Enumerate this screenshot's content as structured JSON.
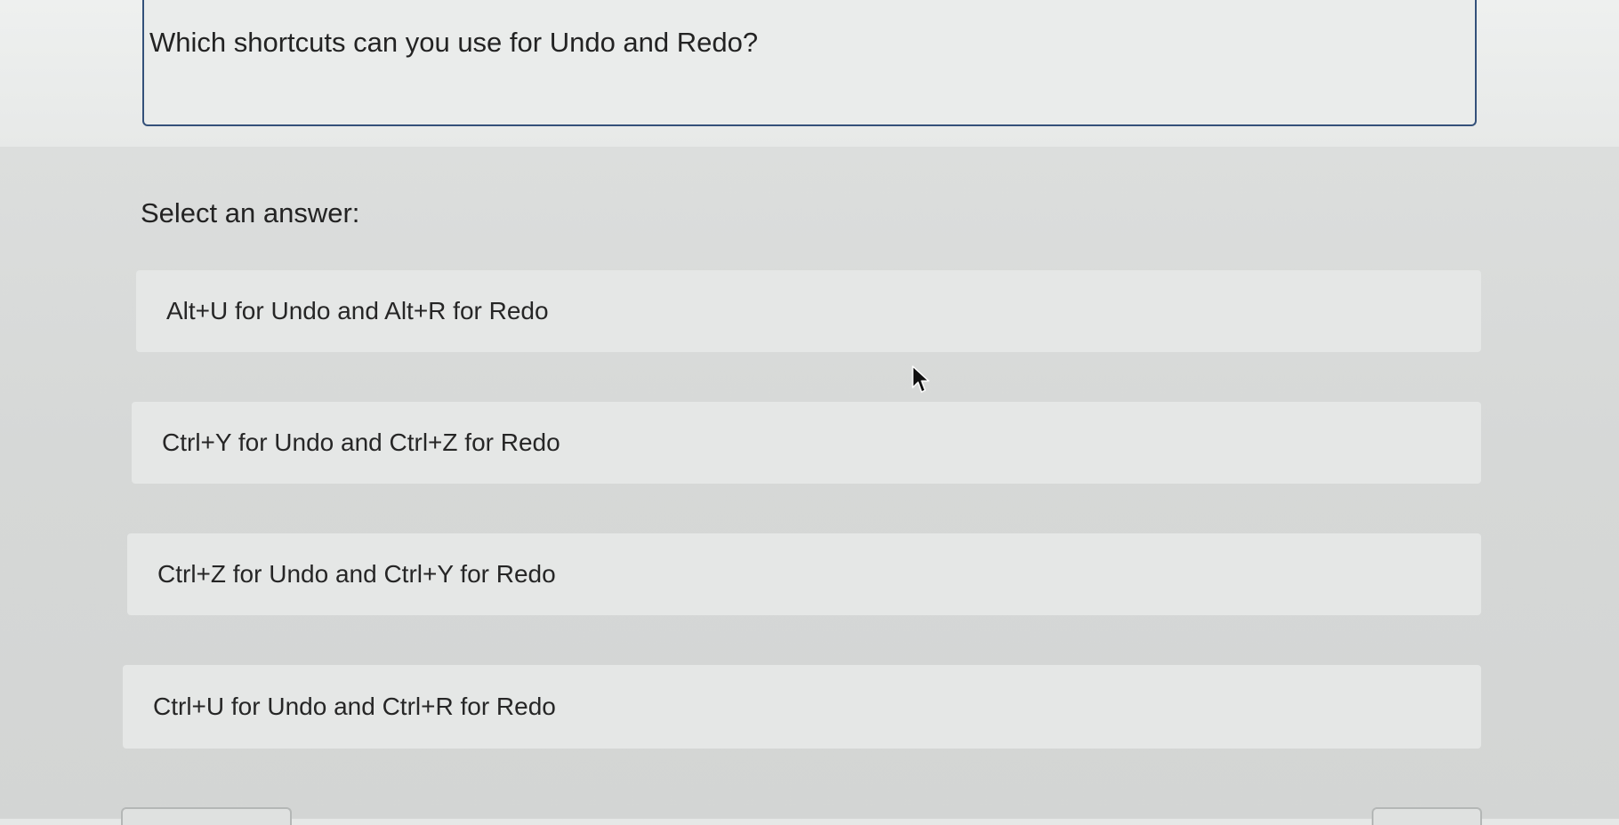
{
  "question": {
    "text": "Which shortcuts can you use for Undo and Redo?"
  },
  "prompt": {
    "text": "Select an answer:"
  },
  "options": [
    {
      "label": "Alt+U for Undo and Alt+R for Redo"
    },
    {
      "label": "Ctrl+Y for Undo and Ctrl+Z for Redo"
    },
    {
      "label": "Ctrl+Z for Undo and Ctrl+Y for Redo"
    },
    {
      "label": "Ctrl+U for Undo and Ctrl+R for Redo"
    }
  ],
  "icons": {
    "cursor": "mouse-pointer-icon"
  },
  "colors": {
    "question_border": "#34517a",
    "option_background": "#e5e7e6",
    "page_background": "#d8dad9"
  }
}
